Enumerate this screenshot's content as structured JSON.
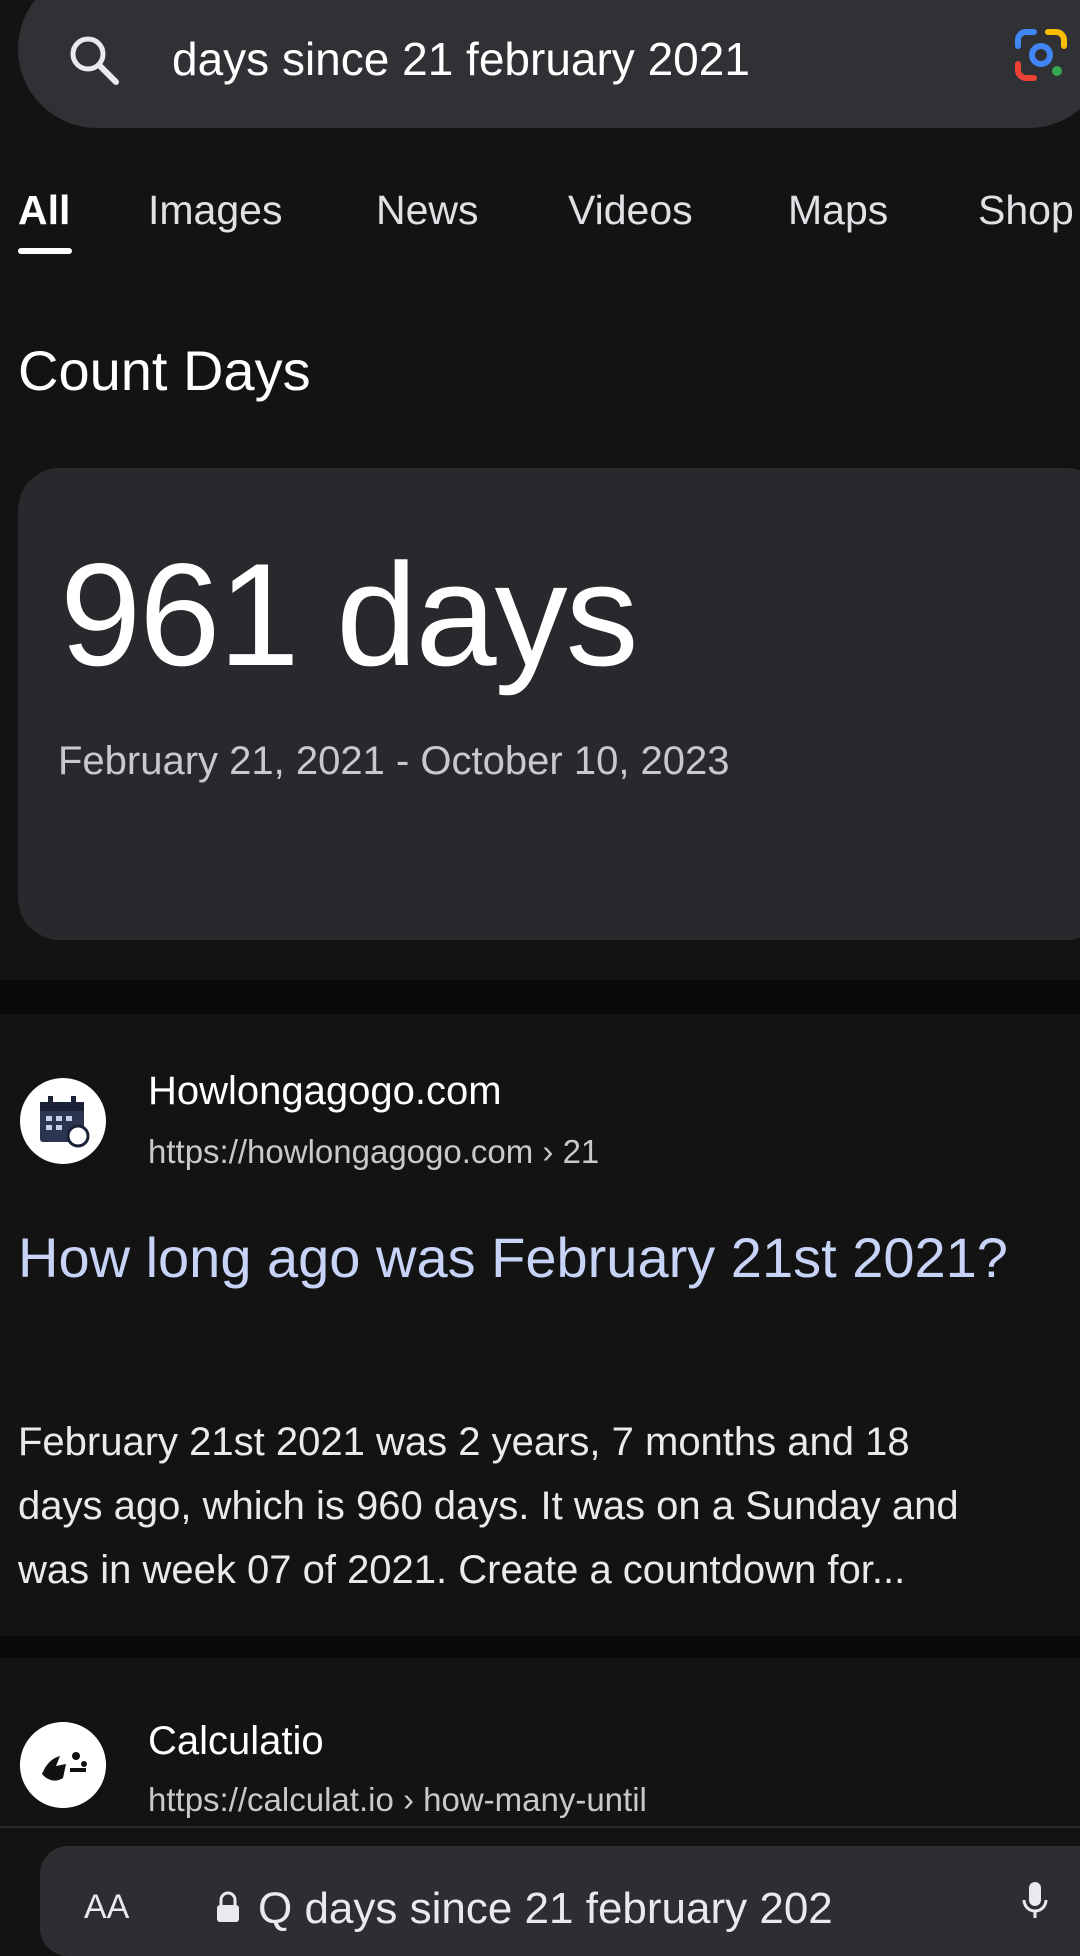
{
  "search": {
    "query": "days since 21 february 2021",
    "search_icon": "search-icon",
    "lens_icon": "google-lens-icon"
  },
  "tabs": [
    {
      "label": "All",
      "active": true
    },
    {
      "label": "Images"
    },
    {
      "label": "News"
    },
    {
      "label": "Videos"
    },
    {
      "label": "Maps"
    },
    {
      "label": "Shop"
    }
  ],
  "count_days": {
    "title": "Count Days",
    "result": "961 days",
    "range": "February 21, 2021 - October 10, 2023"
  },
  "results": [
    {
      "site_name": "Howlongagogo.com",
      "url": "https://howlongagogo.com › 21",
      "favicon": "calendar-icon",
      "title": "How long ago was February 21st 2021?",
      "snippet": [
        "February 21st 2021 was 2 years, 7 months and 18",
        "days ago, which is 960 days. It was on a Sunday and",
        "was in week 07 of 2021. Create a countdown for..."
      ]
    },
    {
      "site_name": "Calculatio",
      "url": "https://calculat.io › how-many-until",
      "favicon": "calculatio-logo-icon"
    }
  ],
  "address_bar": {
    "aa_label": "AA",
    "text": "Q days since 21 february 202",
    "lock_icon": "lock-icon",
    "mic_icon": "microphone-icon"
  },
  "colors": {
    "background": "#131313",
    "surface": "#303134",
    "card": "#28292c",
    "link_title": "#c7d4f7"
  }
}
